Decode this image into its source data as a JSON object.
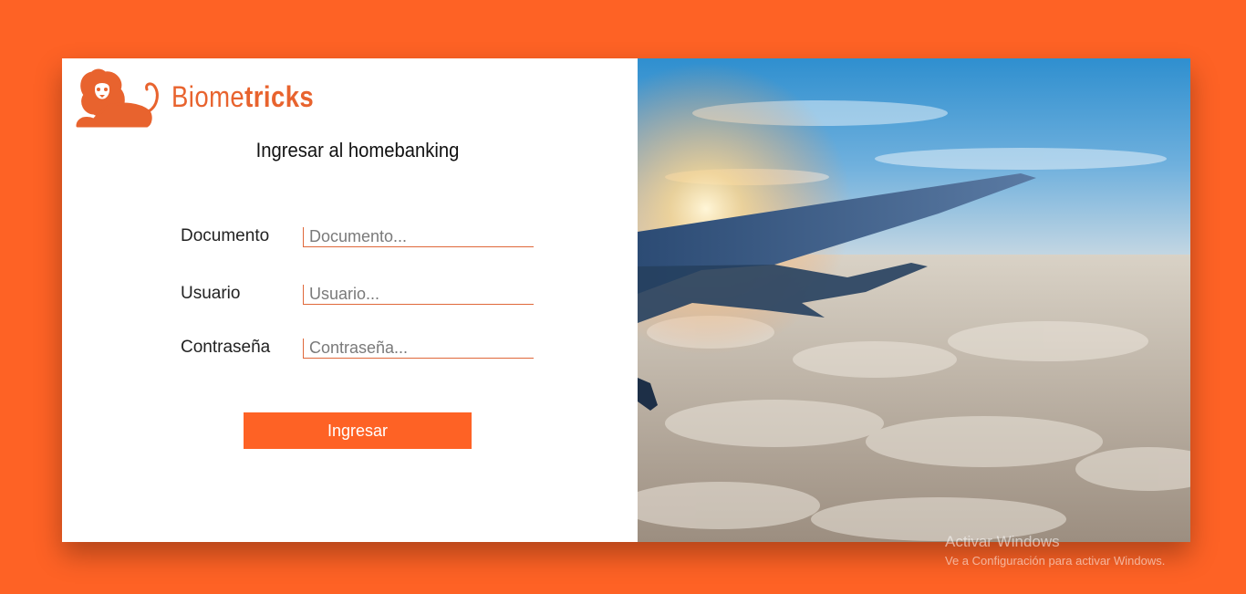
{
  "brand": {
    "name_regular": "Biome",
    "name_bold": "tricks",
    "logo_icon": "lion-icon"
  },
  "login": {
    "heading": "Ingresar al homebanking",
    "fields": [
      {
        "label": "Documento",
        "placeholder": "Documento...",
        "value": ""
      },
      {
        "label": "Usuario",
        "placeholder": "Usuario...",
        "value": ""
      },
      {
        "label": "Contraseña",
        "placeholder": "Contraseña...",
        "value": ""
      }
    ],
    "submit_label": "Ingresar"
  },
  "hero": {
    "image": "airplane-wing-above-clouds"
  },
  "watermark": {
    "title": "Activar Windows",
    "subtitle": "Ve a Configuración para activar Windows."
  },
  "colors": {
    "accent": "#fe6225",
    "brand_text": "#e8632e",
    "input_border": "#e0683a",
    "panel_bg": "#ffffff"
  }
}
